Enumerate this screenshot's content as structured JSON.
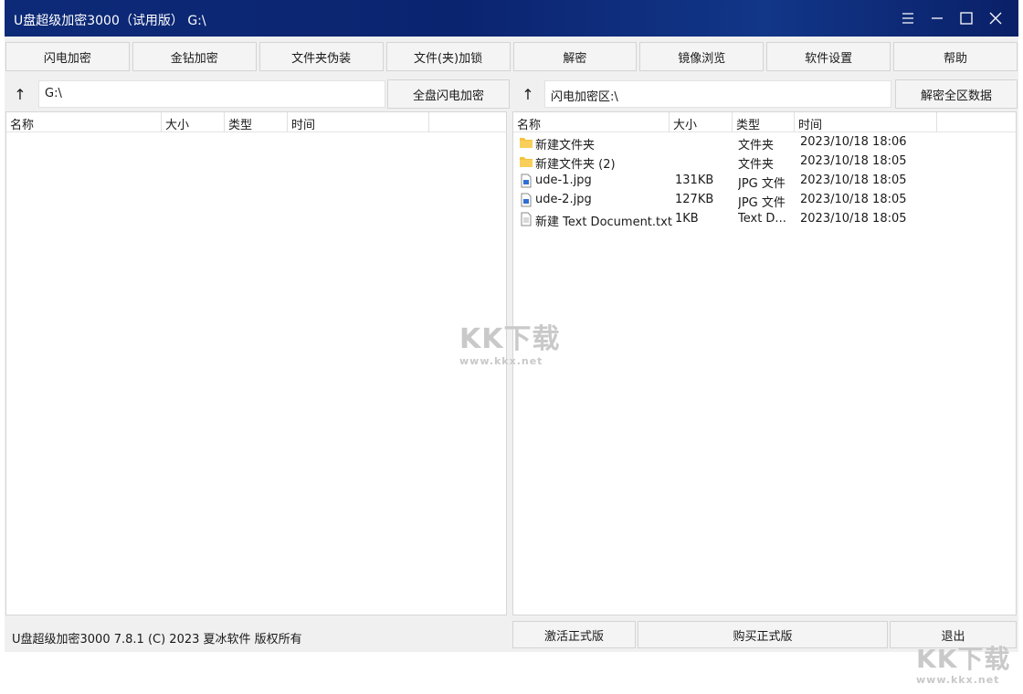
{
  "window": {
    "title": "U盘超级加密3000（试用版）  G:\\",
    "controls": [
      "menu-icon",
      "minimize-icon",
      "maximize-icon",
      "close-icon"
    ]
  },
  "toolbar": {
    "buttons": [
      "闪电加密",
      "金钻加密",
      "文件夹伪装",
      "文件(夹)加锁",
      "解密",
      "镜像浏览",
      "软件设置",
      "帮助"
    ]
  },
  "left": {
    "up_label": "↑",
    "path": "G:\\",
    "action_label": "全盘闪电加密",
    "columns": [
      "名称",
      "大小",
      "类型",
      "时间"
    ],
    "rows": []
  },
  "right": {
    "up_label": "↑",
    "path": "闪电加密区:\\",
    "action_label": "解密全区数据",
    "columns": [
      "名称",
      "大小",
      "类型",
      "时间"
    ],
    "rows": [
      {
        "icon": "folder-icon",
        "name": "新建文件夹",
        "size": "",
        "type": "文件夹",
        "time": "2023/10/18 18:06"
      },
      {
        "icon": "folder-icon",
        "name": "新建文件夹 (2)",
        "size": "",
        "type": "文件夹",
        "time": "2023/10/18 18:05"
      },
      {
        "icon": "image-file-icon",
        "name": "ude-1.jpg",
        "size": "131KB",
        "type": "JPG 文件",
        "time": "2023/10/18 18:05"
      },
      {
        "icon": "image-file-icon",
        "name": "ude-2.jpg",
        "size": "127KB",
        "type": "JPG 文件",
        "time": "2023/10/18 18:05"
      },
      {
        "icon": "text-file-icon",
        "name": "新建 Text Document.txt",
        "size": "1KB",
        "type": "Text D...",
        "time": "2023/10/18 18:05"
      }
    ]
  },
  "status": {
    "text": "U盘超级加密3000 7.8.1 (C) 2023 夏冰软件 版权所有",
    "activate_label": "激活正式版",
    "buy_label": "购买正式版",
    "exit_label": "退出"
  },
  "watermark": {
    "logo": "KK下载",
    "url": "www.kkx.net"
  },
  "colors": {
    "titlebar": "#0d2a78",
    "folder": "#f5c242",
    "image_file": "#2f6fd6"
  }
}
